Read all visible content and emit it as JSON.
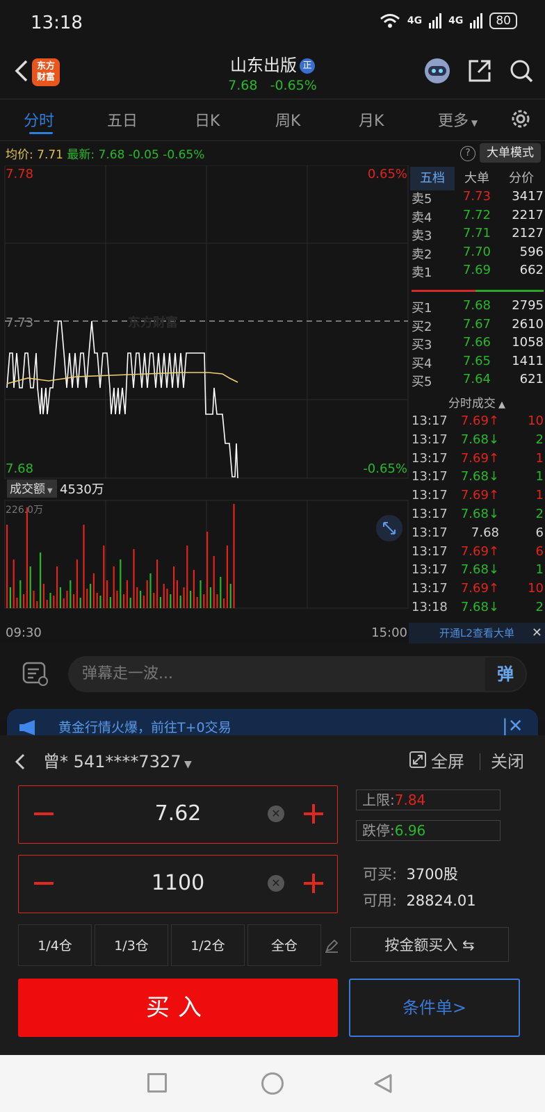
{
  "status": {
    "time": "13:18",
    "net1": "4G",
    "net2": "4G",
    "battery": "80"
  },
  "header": {
    "brand": "东方\n财富",
    "title": "山东出版",
    "badge": "正",
    "price": "7.68",
    "change_pct": "-0.65%"
  },
  "tabs": [
    "分时",
    "五日",
    "日K",
    "周K",
    "月K",
    "更多"
  ],
  "price_line": {
    "avg_label": "均价:",
    "avg": "7.71",
    "latest_label": "最新:",
    "latest": "7.68",
    "chg": "-0.05",
    "chg_pct": "-0.65%",
    "big_order_btn": "大单模式"
  },
  "watermark": "东方财富",
  "chart": {
    "y_high": "7.78",
    "y_mid": "7.73",
    "y_low": "7.68",
    "pct_high": "0.65%",
    "pct_low": "-0.65%",
    "vol_label": "成交额",
    "vol_total": "4530万",
    "vol_max": "226.0万",
    "x_start": "09:30",
    "x_end": "15:00",
    "colors": {
      "price_line": "#ffffff",
      "avg_line": "#f0d070",
      "up": "#e2231a",
      "down": "#27b927"
    }
  },
  "chart_data": {
    "type": "line",
    "title": "",
    "xlabel": "",
    "ylabel": "",
    "ylim": [
      7.68,
      7.78
    ],
    "reference": 7.73,
    "xrange": [
      "09:30",
      "15:00"
    ],
    "series": [],
    "volume_max": "226.0万"
  },
  "book": {
    "tabs": [
      "五档",
      "大单",
      "分价"
    ],
    "asks": [
      {
        "label": "卖5",
        "price": "7.73",
        "vol": "3417",
        "dir": "up"
      },
      {
        "label": "卖4",
        "price": "7.72",
        "vol": "2217",
        "dir": "down"
      },
      {
        "label": "卖3",
        "price": "7.71",
        "vol": "2127",
        "dir": "down"
      },
      {
        "label": "卖2",
        "price": "7.70",
        "vol": "596",
        "dir": "down"
      },
      {
        "label": "卖1",
        "price": "7.69",
        "vol": "662",
        "dir": "down"
      }
    ],
    "bids": [
      {
        "label": "买1",
        "price": "7.68",
        "vol": "2795",
        "dir": "down"
      },
      {
        "label": "买2",
        "price": "7.67",
        "vol": "2610",
        "dir": "down"
      },
      {
        "label": "买3",
        "price": "7.66",
        "vol": "1058",
        "dir": "down"
      },
      {
        "label": "买4",
        "price": "7.65",
        "vol": "1411",
        "dir": "down"
      },
      {
        "label": "买5",
        "price": "7.64",
        "vol": "621",
        "dir": "down"
      }
    ],
    "trades_title": "分时成交",
    "trades": [
      {
        "t": "13:17",
        "p": "7.69",
        "arrow": "↑",
        "v": "10",
        "dir": "up"
      },
      {
        "t": "13:17",
        "p": "7.68",
        "arrow": "↓",
        "v": "2",
        "dir": "down"
      },
      {
        "t": "13:17",
        "p": "7.69",
        "arrow": "↑",
        "v": "1",
        "dir": "up"
      },
      {
        "t": "13:17",
        "p": "7.68",
        "arrow": "↓",
        "v": "1",
        "dir": "down"
      },
      {
        "t": "13:17",
        "p": "7.69",
        "arrow": "↑",
        "v": "1",
        "dir": "up"
      },
      {
        "t": "13:17",
        "p": "7.68",
        "arrow": "↓",
        "v": "2",
        "dir": "down"
      },
      {
        "t": "13:17",
        "p": "7.68",
        "arrow": "",
        "v": "6",
        "dir": "flat"
      },
      {
        "t": "13:17",
        "p": "7.69",
        "arrow": "↑",
        "v": "6",
        "dir": "up"
      },
      {
        "t": "13:17",
        "p": "7.68",
        "arrow": "↓",
        "v": "1",
        "dir": "down"
      },
      {
        "t": "13:17",
        "p": "7.69",
        "arrow": "↑",
        "v": "10",
        "dir": "up"
      },
      {
        "t": "13:18",
        "p": "7.68",
        "arrow": "↓",
        "v": "2",
        "dir": "down"
      }
    ],
    "l2_text": "开通L2查看大单"
  },
  "danmaku": {
    "placeholder": "弹幕走一波...",
    "send": "弹"
  },
  "banner": {
    "text": "黄金行情火爆，前往T+0交易"
  },
  "trade": {
    "account": "曾* 541****7327",
    "fullscreen": "全屏",
    "close": "关闭",
    "price": "7.62",
    "qty": "1100",
    "upper_label": "上限:",
    "upper": "7.84",
    "lower_label": "跌停:",
    "lower": "6.96",
    "can_buy_label": "可买:",
    "can_buy": "3700股",
    "available_label": "可用:",
    "available": "28824.01",
    "positions": [
      "1/4仓",
      "1/3仓",
      "1/2仓",
      "全仓"
    ],
    "amount_btn": "按金额买入 ⇆",
    "buy": "买入",
    "conditional": "条件单>"
  }
}
